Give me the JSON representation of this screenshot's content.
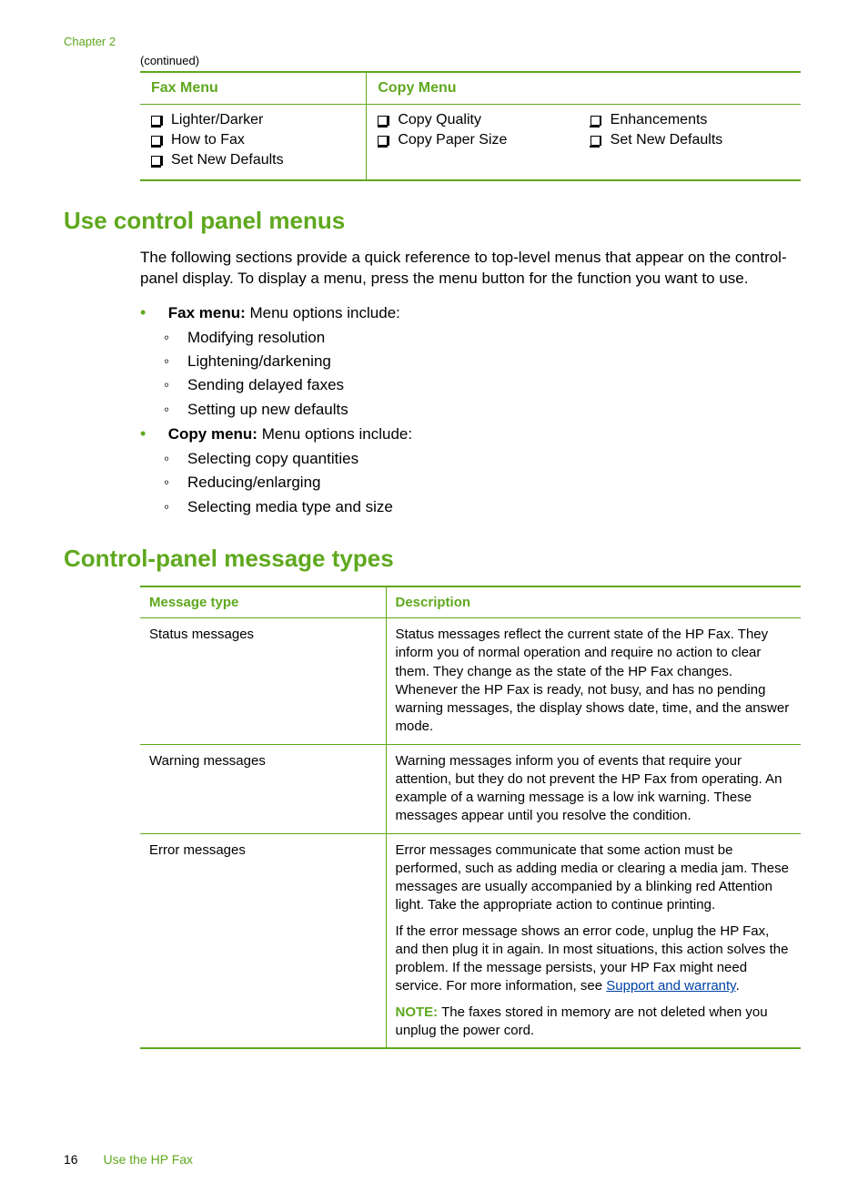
{
  "chapter": "Chapter 2",
  "continued": "(continued)",
  "menu_table": {
    "fax_header": "Fax Menu",
    "copy_header": "Copy Menu",
    "fax_items": [
      "Lighter/Darker",
      "How to Fax",
      "Set New Defaults"
    ],
    "copy_col1": [
      "Copy Quality",
      "Copy Paper Size"
    ],
    "copy_col2": [
      "Enhancements",
      "Set New Defaults"
    ]
  },
  "h_use_menus": "Use control panel menus",
  "intro_text": "The following sections provide a quick reference to top-level menus that appear on the control-panel display. To display a menu, press the menu button for the function you want to use.",
  "fax_menu_label": "Fax menu:",
  "fax_menu_tail": " Menu options include:",
  "fax_sub": [
    "Modifying resolution",
    "Lightening/darkening",
    "Sending delayed faxes",
    "Setting up new defaults"
  ],
  "copy_menu_label": "Copy menu:",
  "copy_menu_tail": " Menu options include:",
  "copy_sub": [
    "Selecting copy quantities",
    "Reducing/enlarging",
    "Selecting media type and size"
  ],
  "h_msg_types": "Control-panel message types",
  "msg_headers": {
    "type": "Message type",
    "desc": "Description"
  },
  "msg_rows": {
    "status": {
      "type": "Status messages",
      "desc": "Status messages reflect the current state of the HP Fax. They inform you of normal operation and require no action to clear them. They change as the state of the HP Fax changes. Whenever the HP Fax is ready, not busy, and has no pending warning messages, the display shows date, time, and the answer mode."
    },
    "warning": {
      "type": "Warning messages",
      "desc": "Warning messages inform you of events that require your attention, but they do not prevent the HP Fax from operating. An example of a warning message is a low ink warning. These messages appear until you resolve the condition."
    },
    "error": {
      "type": "Error messages",
      "p1": "Error messages communicate that some action must be performed, such as adding media or clearing a media jam. These messages are usually accompanied by a blinking red Attention light. Take the appropriate action to continue printing.",
      "p2a": "If the error message shows an error code, unplug the HP Fax, and then plug it in again. In most situations, this action solves the problem. If the message persists, your HP Fax might need service. For more information, see ",
      "p2link": "Support and warranty",
      "p2b": ".",
      "note_label": "NOTE:",
      "note_text": " The faxes stored in memory are not deleted when you unplug the power cord."
    }
  },
  "footer": {
    "page": "16",
    "section": "Use the HP Fax"
  }
}
